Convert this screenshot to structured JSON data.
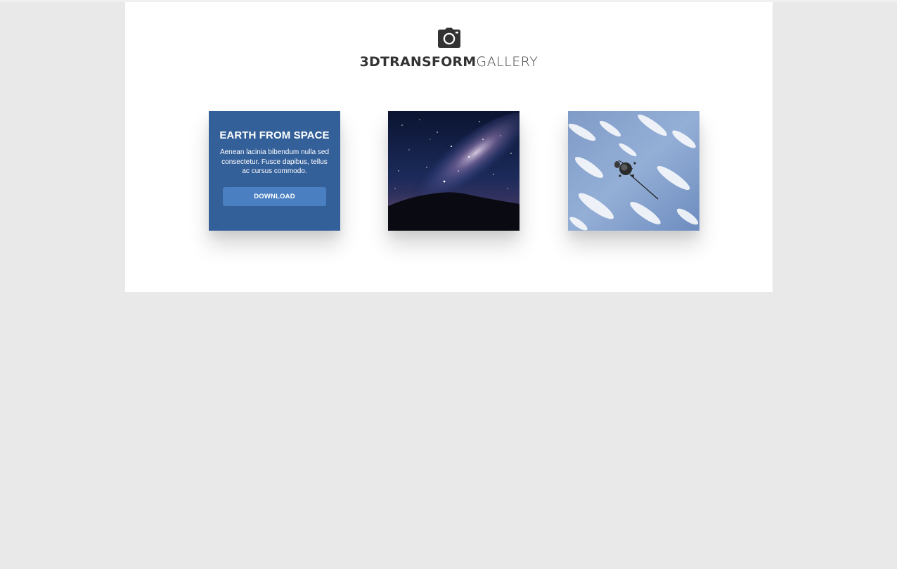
{
  "header": {
    "icon": "camera-icon",
    "brand_bold": "3DTRANSFORM",
    "brand_light": "GALLERY"
  },
  "gallery": {
    "cards": [
      {
        "title": "EARTH FROM SPACE",
        "text": "Aenean lacinia bibendum nulla sed consectetur. Fusce dapibus, tellus ac cursus commodo.",
        "button_label": "DOWNLOAD",
        "image": "earth-from-space-image"
      },
      {
        "image": "milky-way-night-sky-image"
      },
      {
        "image": "satellite-over-clouds-image"
      }
    ]
  },
  "colors": {
    "background": "#e9e9e9",
    "panel": "#ffffff",
    "card_overlay": "#34609a",
    "button": "#4a80c1",
    "text_dark": "#333333"
  }
}
